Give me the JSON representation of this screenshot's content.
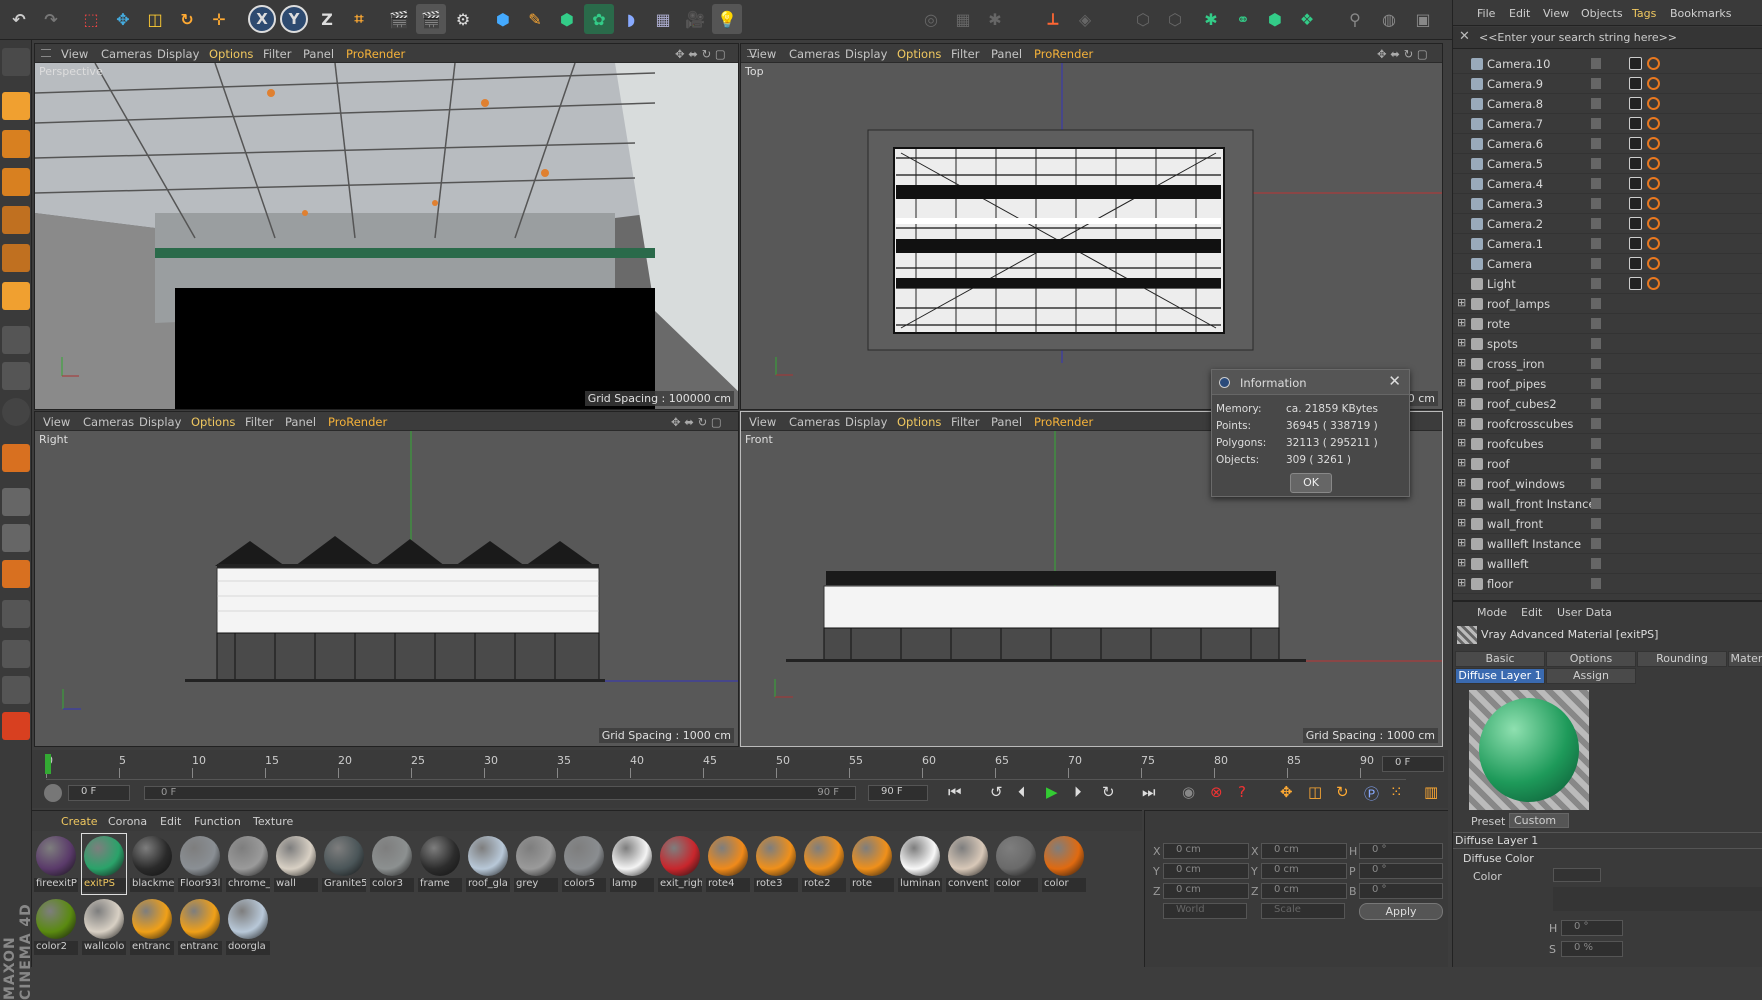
{
  "top_toolbar": {
    "axis_x": "X",
    "axis_y": "Y",
    "axis_z": "Z"
  },
  "viewports": [
    {
      "name": "Perspective",
      "grid": "Grid Spacing : 100000 cm"
    },
    {
      "name": "Top",
      "grid": "0 cm"
    },
    {
      "name": "Right",
      "grid": "Grid Spacing : 1000 cm"
    },
    {
      "name": "Front",
      "grid": "Grid Spacing : 1000 cm"
    }
  ],
  "viewport_menu": {
    "view": "View",
    "cameras": "Cameras",
    "display": "Display",
    "options": "Options",
    "filter": "Filter",
    "panel": "Panel",
    "prorender": "ProRender"
  },
  "right_menu": {
    "file": "File",
    "edit": "Edit",
    "view": "View",
    "objects": "Objects",
    "tags": "Tags",
    "bookmarks": "Bookmarks"
  },
  "search_placeholder": "<<Enter your search string here>>",
  "objects": [
    "Camera.10",
    "Camera.9",
    "Camera.8",
    "Camera.7",
    "Camera.6",
    "Camera.5",
    "Camera.4",
    "Camera.3",
    "Camera.2",
    "Camera.1",
    "Camera",
    "Light",
    "roof_lamps",
    "rote",
    "spots",
    "cross_iron",
    "roof_pipes",
    "roof_cubes2",
    "roofcrosscubes",
    "roofcubes",
    "roof",
    "roof_windows",
    "wall_front Instance",
    "wall_front",
    "wallleft Instance",
    "wallleft",
    "floor"
  ],
  "attributes": {
    "mode": "Mode",
    "edit": "Edit",
    "user_data": "User Data",
    "material_title": "Vray Advanced Material [exitPS]",
    "tabs": [
      "Basic",
      "Options",
      "Rounding",
      "Materi"
    ],
    "subtabs": [
      "Diffuse Layer 1",
      "Assign"
    ],
    "preset_label": "Preset",
    "preset_value": "Custom",
    "section": "Diffuse Layer 1",
    "subsection": "Diffuse Color",
    "color_label": "Color",
    "h_label": "H",
    "h_value": "0 °",
    "s_label": "S",
    "s_value": "0 %"
  },
  "dialog": {
    "title": "Information",
    "memory_label": "Memory:",
    "memory": "ca. 21859 KBytes",
    "points_label": "Points:",
    "points": "36945 ( 338719 )",
    "polygons_label": "Polygons:",
    "polygons": "32113 ( 295211 )",
    "objects_label": "Objects:",
    "objects": "309 ( 3261 )",
    "ok": "OK"
  },
  "timeline": {
    "ticks": [
      "0",
      "5",
      "10",
      "15",
      "20",
      "25",
      "30",
      "35",
      "40",
      "45",
      "50",
      "55",
      "60",
      "65",
      "70",
      "75",
      "80",
      "85",
      "90"
    ],
    "current_frame": "0 F",
    "start": "0 F",
    "end_inner": "90 F",
    "end": "90 F",
    "slider_start": "0 F"
  },
  "materials_menu": {
    "create": "Create",
    "corona": "Corona",
    "edit": "Edit",
    "function": "Function",
    "texture": "Texture"
  },
  "materials": [
    {
      "name": "fireexitP",
      "color": "#5a3a6a"
    },
    {
      "name": "exitPS",
      "color": "#2aa36a"
    },
    {
      "name": "blackme",
      "color": "#2a2a2a"
    },
    {
      "name": "Floor93l",
      "color": "#8a8f94"
    },
    {
      "name": "chrome_",
      "color": "#9a9a9a"
    },
    {
      "name": "wall",
      "color": "#d8d0c4"
    },
    {
      "name": "Granite5",
      "color": "#4a5558"
    },
    {
      "name": "color3",
      "color": "#8c9090"
    },
    {
      "name": "frame",
      "color": "#2c2c2c"
    },
    {
      "name": "roof_gla",
      "color": "#b8c8d8"
    },
    {
      "name": "grey",
      "color": "#9a9a9a"
    },
    {
      "name": "color5",
      "color": "#8a8d90"
    },
    {
      "name": "lamp",
      "color": "#f4f4f4"
    },
    {
      "name": "exit_righ",
      "color": "#c8262c"
    },
    {
      "name": "rote4",
      "color": "#f08a1a"
    },
    {
      "name": "rote3",
      "color": "#f0901a"
    },
    {
      "name": "rote2",
      "color": "#f0901a"
    },
    {
      "name": "rote",
      "color": "#f0901a"
    },
    {
      "name": "luminan",
      "color": "#f8f8f8"
    },
    {
      "name": "convent",
      "color": "#d8c8b8"
    },
    {
      "name": "color",
      "color": "#6a6a6a"
    },
    {
      "name": "color",
      "color": "#e06a10"
    },
    {
      "name": "color2",
      "color": "#5a8a10"
    },
    {
      "name": "wallcolo",
      "color": "#d8d0c4"
    },
    {
      "name": "entranc",
      "color": "#f0a018"
    },
    {
      "name": "entranc",
      "color": "#f0a018"
    },
    {
      "name": "doorgla",
      "color": "#b8c8d8"
    }
  ],
  "coords": {
    "x": "X",
    "y": "Y",
    "z": "Z",
    "h": "H",
    "p": "P",
    "b": "B",
    "x_val": "0 cm",
    "y_val": "0 cm",
    "z_val": "0 cm",
    "x2_val": "0 cm",
    "y2_val": "0 cm",
    "z2_val": "0 cm",
    "h_val": "0 °",
    "p_val": "0 °",
    "b_val": "0 °",
    "world": "World",
    "scale": "Scale",
    "apply": "Apply"
  },
  "brand": "MAXON CINEMA 4D"
}
